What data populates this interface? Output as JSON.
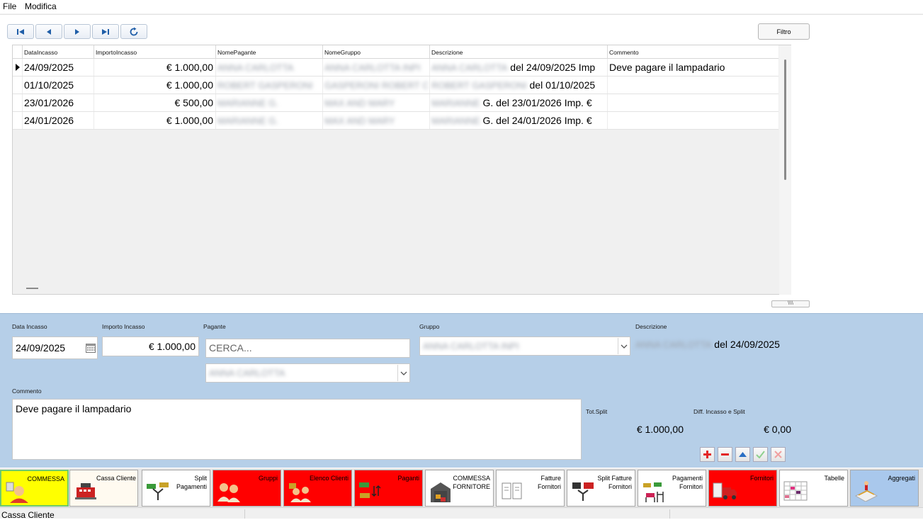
{
  "menu": {
    "file": "File",
    "edit": "Modifica"
  },
  "toolbar": {
    "filter_label": "Filtro"
  },
  "grid": {
    "columns": [
      "DataIncasso",
      "ImportoIncasso",
      "NomePagante",
      "NomeGruppo",
      "Descrizione",
      "Commento"
    ],
    "rows": [
      {
        "data": "24/09/2025",
        "importo": "€ 1.000,00",
        "pagante": "ANNA CARLOTTA",
        "gruppo": "ANNA CARLOTTA INPI",
        "descr_blur": "ANNA CARLOTTA",
        "descr": " del 24/09/2025 Imp",
        "commento": "Deve pagare il lampadario"
      },
      {
        "data": "01/10/2025",
        "importo": "€ 1.000,00",
        "pagante": "ROBERT GASPERONI",
        "gruppo": "GASPERONI ROBERT C",
        "descr_blur": "ROBERT GASPERONI",
        "descr": " del 01/10/2025",
        "commento": ""
      },
      {
        "data": "23/01/2026",
        "importo": "€ 500,00",
        "pagante": "MARIANNE G.",
        "gruppo": "MAX AND MARY",
        "descr_blur": "MARIANNE",
        "descr": " G. del 23/01/2026 Imp. €",
        "commento": ""
      },
      {
        "data": "24/01/2026",
        "importo": "€ 1.000,00",
        "pagante": "MARIANNE G.",
        "gruppo": "MAX AND MARY",
        "descr_blur": "MARIANNE",
        "descr": " G. del 24/01/2026 Imp. €",
        "commento": ""
      }
    ],
    "splitter_label": "\\\\\\\\"
  },
  "form": {
    "data_label": "Data Incasso",
    "data_value": "24/09/2025",
    "importo_label": "Importo Incasso",
    "importo_value": "€ 1.000,00",
    "pagante_label": "Pagante",
    "search_placeholder": "CERCA...",
    "pagante_selected": "ANNA CARLOTTA",
    "gruppo_label": "Gruppo",
    "gruppo_selected": "ANNA CARLOTTA INPI",
    "descrizione_label": "Descrizione",
    "descrizione_blur": "ANNA CARLOTTA",
    "descrizione_value": " del 24/09/2025",
    "commento_label": "Commento",
    "commento_value": "Deve pagare il lampadario",
    "tot_split_label": "Tot.Split",
    "tot_split_value": "€ 1.000,00",
    "diff_label": "Diff. Incasso e Split",
    "diff_value": "€ 0,00"
  },
  "tabs": [
    {
      "label": "COMMESSA",
      "bg": "#ffff00",
      "icon": "person-icon"
    },
    {
      "label": "Cassa Cliente",
      "bg": "#fffaf0",
      "icon": "cash-register-icon"
    },
    {
      "label": "Split\nPagamenti",
      "bg": "#ffffff",
      "icon": "split-money-icon"
    },
    {
      "label": "Gruppi",
      "bg": "#ff0000",
      "icon": "group-icon"
    },
    {
      "label": "Elenco Clienti",
      "bg": "#ff0000",
      "icon": "clients-icon"
    },
    {
      "label": "Paganti",
      "bg": "#ff0000",
      "icon": "payers-icon"
    },
    {
      "label": "COMMESSA\nFORNITORE",
      "bg": "#ffffff",
      "icon": "warehouse-icon"
    },
    {
      "label": "Fatture\nFornitori",
      "bg": "#ffffff",
      "icon": "invoice-icon"
    },
    {
      "label": "Split Fatture\nFornitori",
      "bg": "#ffffff",
      "icon": "split-invoice-icon"
    },
    {
      "label": "Pagamenti\nFornitori",
      "bg": "#ffffff",
      "icon": "supplier-payment-icon"
    },
    {
      "label": "Fornitori",
      "bg": "#ff0000",
      "icon": "truck-icon"
    },
    {
      "label": "Tabelle",
      "bg": "#ffffff",
      "icon": "table-icon"
    },
    {
      "label": "Aggregati",
      "bg": "#a9c8ec",
      "icon": "aggregate-icon"
    }
  ],
  "status": {
    "text": "Cassa Cliente"
  }
}
